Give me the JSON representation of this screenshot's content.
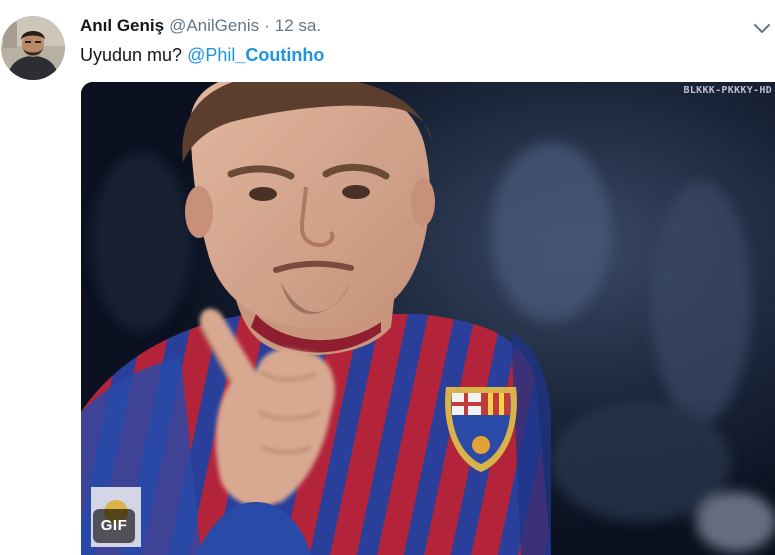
{
  "tweet": {
    "display_name": "Anıl Geniş",
    "screen_name": "@AnilGenis",
    "separator": "·",
    "timestamp": "12 sa.",
    "text_prefix": "Uyudun mu? ",
    "mention_prefix": "@Phil",
    "mention_bold": "_Coutinho",
    "avatar_icon": "user-avatar",
    "menu_icon": "chevron-down-icon"
  },
  "media": {
    "watermark": "BLKKK-PKKKY-HD",
    "badge": "GIF",
    "kind": "animated-gif"
  },
  "colors": {
    "link": "#1b95e0",
    "text_primary": "#14171a",
    "text_secondary": "#657786",
    "jersey_red": "#b3243b",
    "jersey_blue": "#2a4aa8"
  }
}
